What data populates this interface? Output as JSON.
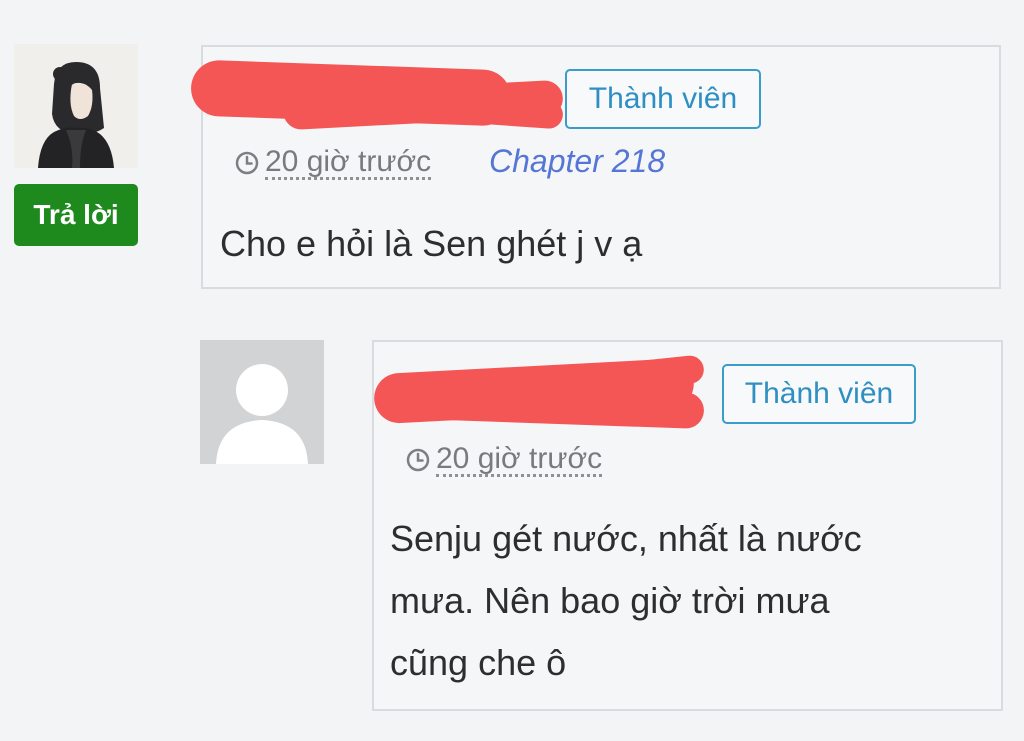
{
  "comments": [
    {
      "reply_label": "Trả lời",
      "badge": "Thành viên",
      "time": "20 giờ trước",
      "chapter": "Chapter 218",
      "text": "Cho e hỏi là Sen ghét j v ạ"
    },
    {
      "badge": "Thành viên",
      "time": "20 giờ trước",
      "text_lines": [
        "Senju gét nước, nhất là nước",
        "mưa. Nên bao giờ trời mưa",
        "cũng che ô"
      ]
    }
  ],
  "colors": {
    "reply_button": "#1e8a1e",
    "badge": "#2f8fc2",
    "chapter_link": "#5576d6",
    "redaction": "#f45656"
  },
  "icons": [
    "clock-icon",
    "default-avatar-icon"
  ]
}
